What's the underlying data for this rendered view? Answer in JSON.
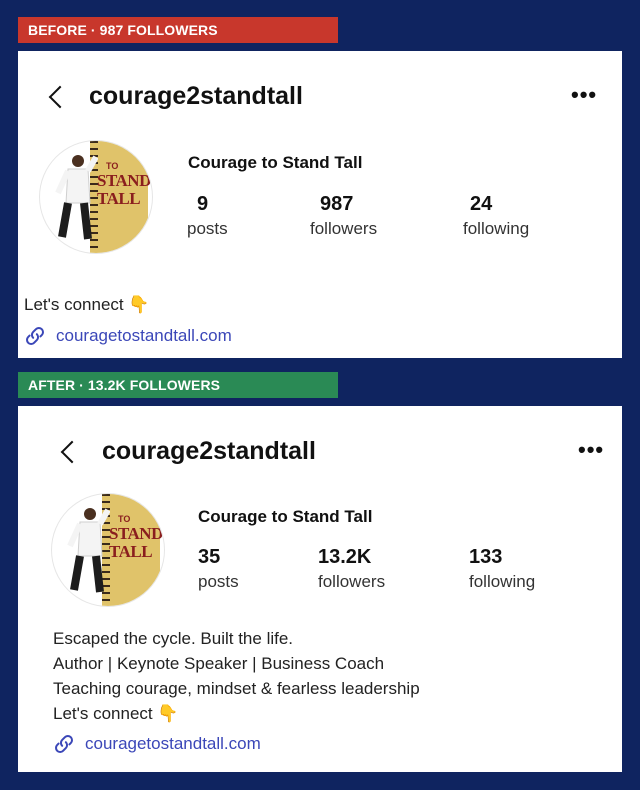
{
  "before": {
    "banner": "BEFORE · 987 FOLLOWERS",
    "handle": "courage2standtall",
    "display_name": "Courage to Stand Tall",
    "stats": {
      "posts": {
        "value": "9",
        "label": "posts"
      },
      "followers": {
        "value": "987",
        "label": "followers"
      },
      "following": {
        "value": "24",
        "label": "following"
      }
    },
    "bio": [
      "Let's connect 👇"
    ],
    "link": "couragetostandtall.com",
    "avatar": {
      "small_text": "TO",
      "big_text_1": "STAND",
      "big_text_2": "TALL"
    }
  },
  "after": {
    "banner": "AFTER · 13.2K FOLLOWERS",
    "handle": "courage2standtall",
    "display_name": "Courage to Stand Tall",
    "stats": {
      "posts": {
        "value": "35",
        "label": "posts"
      },
      "followers": {
        "value": "13.2K",
        "label": "followers"
      },
      "following": {
        "value": "133",
        "label": "following"
      }
    },
    "bio": [
      "Escaped the cycle. Built the life.",
      "Author | Keynote Speaker | Business Coach",
      "Teaching courage, mindset & fearless leadership",
      "Let's connect 👇"
    ],
    "link": "couragetostandtall.com",
    "avatar": {
      "small_text": "TO",
      "big_text_1": "STAND",
      "big_text_2": "TALL"
    }
  },
  "icons": {
    "back": "chevron-left-icon",
    "more": "more-horizontal-icon",
    "link": "link-icon"
  },
  "colors": {
    "background": "#0f2460",
    "before_banner": "#c8372c",
    "after_banner": "#2a8a55",
    "link": "#3b47b8"
  }
}
